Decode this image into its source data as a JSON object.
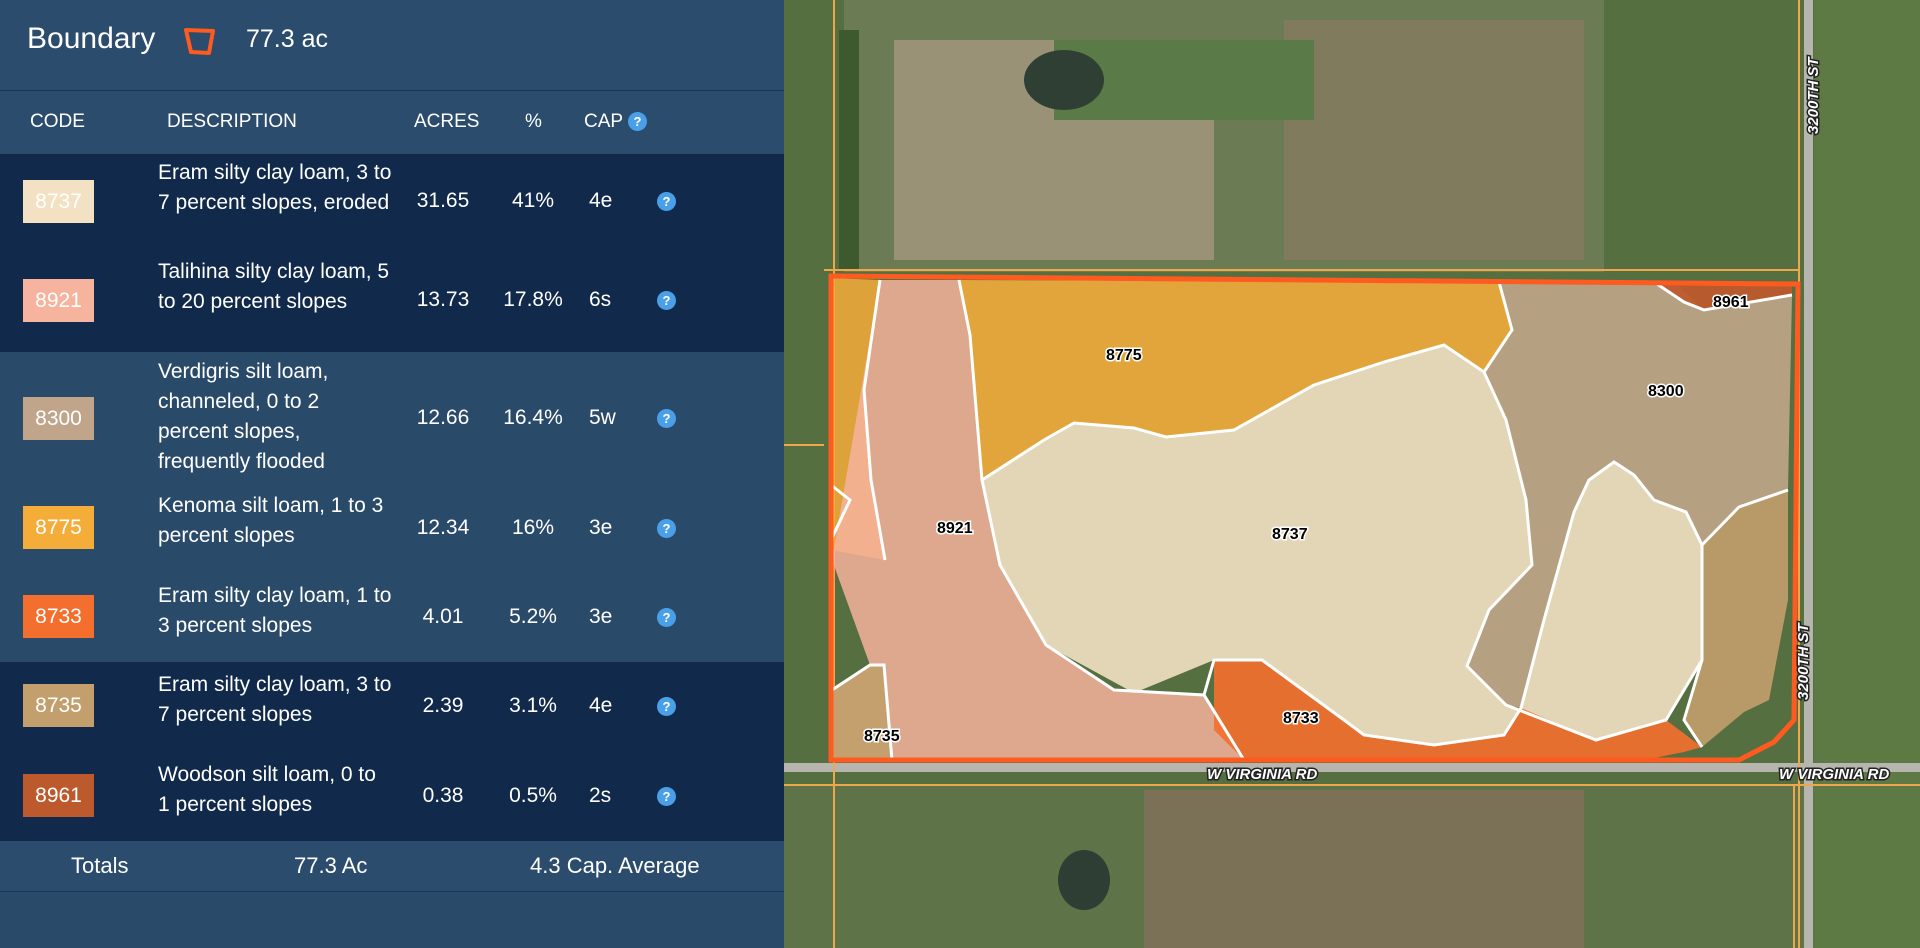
{
  "header": {
    "title": "Boundary",
    "total_acres": "77.3 ac"
  },
  "columns": {
    "code": "CODE",
    "description": "DESCRIPTION",
    "acres": "ACRES",
    "percent": "%",
    "cap": "CAP"
  },
  "rows": [
    {
      "code": "8737",
      "color": "#f3e1c3",
      "description": "Eram silty clay loam, 3 to 7 percent slopes, eroded",
      "acres": "31.65",
      "percent": "41%",
      "cap": "4e"
    },
    {
      "code": "8921",
      "color": "#f6b39d",
      "description": "Talihina silty clay loam, 5 to 20 percent slopes",
      "acres": "13.73",
      "percent": "17.8%",
      "cap": "6s"
    },
    {
      "code": "8300",
      "color": "#c0a58a",
      "description": "Verdigris silt loam, channeled, 0 to 2 percent slopes, frequently flooded",
      "acres": "12.66",
      "percent": "16.4%",
      "cap": "5w"
    },
    {
      "code": "8775",
      "color": "#f5ad3a",
      "description": "Kenoma silt loam, 1 to 3 percent slopes",
      "acres": "12.34",
      "percent": "16%",
      "cap": "3e"
    },
    {
      "code": "8733",
      "color": "#f46f2d",
      "description": "Eram silty clay loam, 1 to 3 percent slopes",
      "acres": "4.01",
      "percent": "5.2%",
      "cap": "3e"
    },
    {
      "code": "8735",
      "color": "#c29f6c",
      "description": "Eram silty clay loam, 3 to 7 percent slopes",
      "acres": "2.39",
      "percent": "3.1%",
      "cap": "4e"
    },
    {
      "code": "8961",
      "color": "#bd5a2d",
      "description": "Woodson silt loam, 0 to 1 percent slopes",
      "acres": "0.38",
      "percent": "0.5%",
      "cap": "2s"
    }
  ],
  "totals": {
    "label": "Totals",
    "acres": "77.3 Ac",
    "cap_average": "4.3 Cap. Average"
  },
  "map": {
    "soil_labels": [
      "8737",
      "8921",
      "8300",
      "8775",
      "8733",
      "8735",
      "8961"
    ],
    "roads": {
      "west_east": "W VIRGINIA RD",
      "north_south": "3200TH ST"
    }
  },
  "icons": {
    "boundary": "polygon-boundary-icon",
    "help": "question-circle-icon",
    "help_glyph": "?"
  },
  "colors": {
    "boundary_outline": "#ff5a1f",
    "panel_bg": "#2a4a6a",
    "row_dark": "#11294a",
    "help_icon": "#4aa0e8"
  }
}
